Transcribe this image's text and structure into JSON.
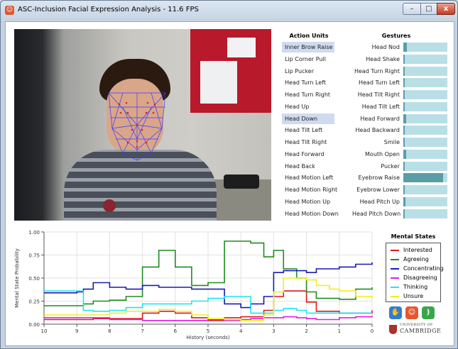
{
  "window": {
    "title": "ASC-Inclusion Facial Expression Analysis - 11.6 FPS",
    "icon_glyph": "☺",
    "min_glyph": "–",
    "max_glyph": "□",
    "close_glyph": "x"
  },
  "action_units": {
    "header": "Action Units",
    "items": [
      {
        "label": "Inner Brow Raise",
        "active": true
      },
      {
        "label": "Lip Corner Pull",
        "active": false
      },
      {
        "label": "Lip Pucker",
        "active": false
      },
      {
        "label": "Head Turn Left",
        "active": false
      },
      {
        "label": "Head Turn Right",
        "active": false
      },
      {
        "label": "Head Up",
        "active": false
      },
      {
        "label": "Head Down",
        "active": true
      },
      {
        "label": "Head Tilt Left",
        "active": false
      },
      {
        "label": "Head Tilt Right",
        "active": false
      },
      {
        "label": "Head Forward",
        "active": false
      },
      {
        "label": "Head Back",
        "active": false
      },
      {
        "label": "Head Motion Left",
        "active": false
      },
      {
        "label": "Head Motion Right",
        "active": false
      },
      {
        "label": "Head Motion Up",
        "active": false
      },
      {
        "label": "Head Motion Down",
        "active": false
      }
    ]
  },
  "gestures": {
    "header": "Gestures",
    "items": [
      {
        "label": "Head Nod",
        "level": 0.08
      },
      {
        "label": "Head Shake",
        "level": 0.04
      },
      {
        "label": "Head Turn Right",
        "level": 0.02
      },
      {
        "label": "Head Turn Left",
        "level": 0.02
      },
      {
        "label": "Head Tilt Right",
        "level": 0.04
      },
      {
        "label": "Head Tilt Left",
        "level": 0.03
      },
      {
        "label": "Head Forward",
        "level": 0.06
      },
      {
        "label": "Head Backward",
        "level": 0.04
      },
      {
        "label": "Smile",
        "level": 0.04
      },
      {
        "label": "Mouth Open",
        "level": 0.06
      },
      {
        "label": "Pucker",
        "level": 0.04
      },
      {
        "label": "Eyebrow Raise",
        "level": 0.9
      },
      {
        "label": "Eyebrow Lower",
        "level": 0.04
      },
      {
        "label": "Head Pitch Up",
        "level": 0.05
      },
      {
        "label": "Head Pitch Down",
        "level": 0.02
      }
    ]
  },
  "mental_states": {
    "title": "Mental States",
    "items": [
      {
        "label": "Interested",
        "color": "#e01818"
      },
      {
        "label": "Agreeing",
        "color": "#1e8c1e"
      },
      {
        "label": "Concentrating",
        "color": "#1a1ab4"
      },
      {
        "label": "Disagreeing",
        "color": "#e01ce0"
      },
      {
        "label": "Thinking",
        "color": "#1ee6f0"
      },
      {
        "label": "Unsure",
        "color": "#f0f01a"
      }
    ]
  },
  "logos": {
    "cambridge_line1": "UNIVERSITY OF",
    "cambridge_line2": "CAMBRIDGE",
    "icon_a": "hand-icon",
    "icon_b": "smiley-icon",
    "icon_c": "speech-icon"
  },
  "chart_data": {
    "type": "line",
    "xlabel": "History (seconds)",
    "ylabel": "Mental State Probability",
    "xlim": [
      10,
      0
    ],
    "ylim": [
      0,
      1
    ],
    "xticks": [
      10,
      9,
      8,
      7,
      6,
      5,
      4,
      3,
      2,
      1,
      0
    ],
    "yticks": [
      "0.00",
      "0.25",
      "0.50",
      "0.75",
      "1.00"
    ],
    "grid": true,
    "x": [
      10,
      9.5,
      9,
      8.8,
      8.5,
      8,
      7.5,
      7,
      6.5,
      6,
      5.5,
      5,
      4.5,
      4,
      3.7,
      3.3,
      3,
      2.7,
      2.3,
      2,
      1.7,
      1.3,
      1,
      0.5,
      0
    ],
    "series": [
      {
        "name": "Interested",
        "values": [
          0.05,
          0.05,
          0.05,
          0.05,
          0.06,
          0.06,
          0.06,
          0.12,
          0.14,
          0.12,
          0.07,
          0.04,
          0.07,
          0.08,
          0.08,
          0.15,
          0.3,
          0.36,
          0.36,
          0.24,
          0.14,
          0.14,
          0.12,
          0.12,
          0.15
        ]
      },
      {
        "name": "Agreeing",
        "values": [
          0.2,
          0.2,
          0.2,
          0.22,
          0.25,
          0.26,
          0.3,
          0.62,
          0.8,
          0.62,
          0.42,
          0.45,
          0.9,
          0.9,
          0.88,
          0.73,
          0.8,
          0.6,
          0.5,
          0.35,
          0.28,
          0.28,
          0.27,
          0.38,
          0.4
        ]
      },
      {
        "name": "Concentrating",
        "values": [
          0.34,
          0.34,
          0.35,
          0.38,
          0.45,
          0.4,
          0.38,
          0.42,
          0.4,
          0.4,
          0.38,
          0.38,
          0.22,
          0.18,
          0.22,
          0.3,
          0.56,
          0.58,
          0.58,
          0.56,
          0.6,
          0.6,
          0.62,
          0.65,
          0.67
        ]
      },
      {
        "name": "Disagreeing",
        "values": [
          0.07,
          0.07,
          0.07,
          0.07,
          0.07,
          0.05,
          0.05,
          0.04,
          0.04,
          0.04,
          0.04,
          0.05,
          0.04,
          0.05,
          0.06,
          0.07,
          0.07,
          0.08,
          0.07,
          0.06,
          0.05,
          0.05,
          0.07,
          0.08,
          0.09
        ]
      },
      {
        "name": "Thinking",
        "values": [
          0.36,
          0.36,
          0.36,
          0.15,
          0.14,
          0.15,
          0.18,
          0.22,
          0.22,
          0.22,
          0.25,
          0.28,
          0.3,
          0.3,
          0.12,
          0.12,
          0.15,
          0.17,
          0.15,
          0.12,
          0.12,
          0.12,
          0.12,
          0.12,
          0.12
        ]
      },
      {
        "name": "Unsure",
        "values": [
          0.1,
          0.1,
          0.1,
          0.1,
          0.1,
          0.12,
          0.14,
          0.14,
          0.16,
          0.14,
          0.1,
          0.06,
          0.05,
          0.04,
          0.04,
          0.1,
          0.35,
          0.5,
          0.5,
          0.48,
          0.42,
          0.38,
          0.36,
          0.3,
          0.28
        ]
      }
    ]
  }
}
